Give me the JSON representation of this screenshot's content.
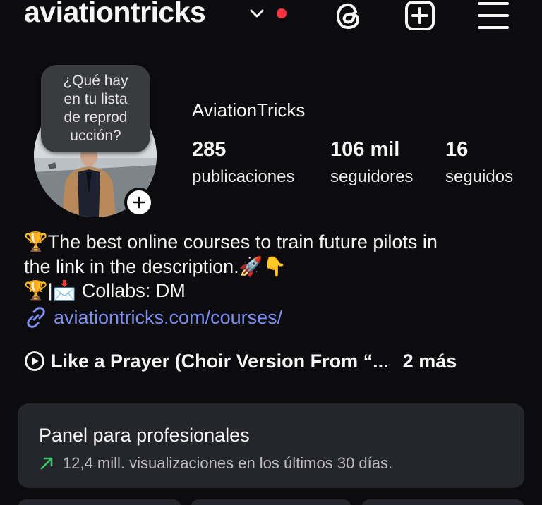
{
  "header": {
    "username": "aviationtricks",
    "icons": [
      "chevron-down-icon",
      "notification-dot",
      "threads-icon",
      "add-post-icon",
      "menu-icon"
    ],
    "accent_red": "#ff3040"
  },
  "note": {
    "text": "¿Qué hay\nen tu lista\nde reprod\nucción?"
  },
  "profile": {
    "display_name": "AviationTricks",
    "stats": [
      {
        "value": "285",
        "label": "publicaciones"
      },
      {
        "value": "106 mil",
        "label": "seguidores"
      },
      {
        "value": "16",
        "label": "seguidos"
      }
    ]
  },
  "bio": {
    "line1": "🏆The best online courses to train future pilots in",
    "line2": "the link in the description.🚀👇",
    "line3": "🏆|📩 Collabs: DM",
    "link": "aviationtricks.com/courses/",
    "link_color": "#7d8ef2"
  },
  "music": {
    "track": "Like a Prayer (Choir Version From “...",
    "more": "2 más"
  },
  "pro_panel": {
    "title": "Panel para profesionales",
    "subtitle": "12,4 mill. visualizaciones en los últimos 30 días.",
    "trend_color": "#3fc46a"
  }
}
